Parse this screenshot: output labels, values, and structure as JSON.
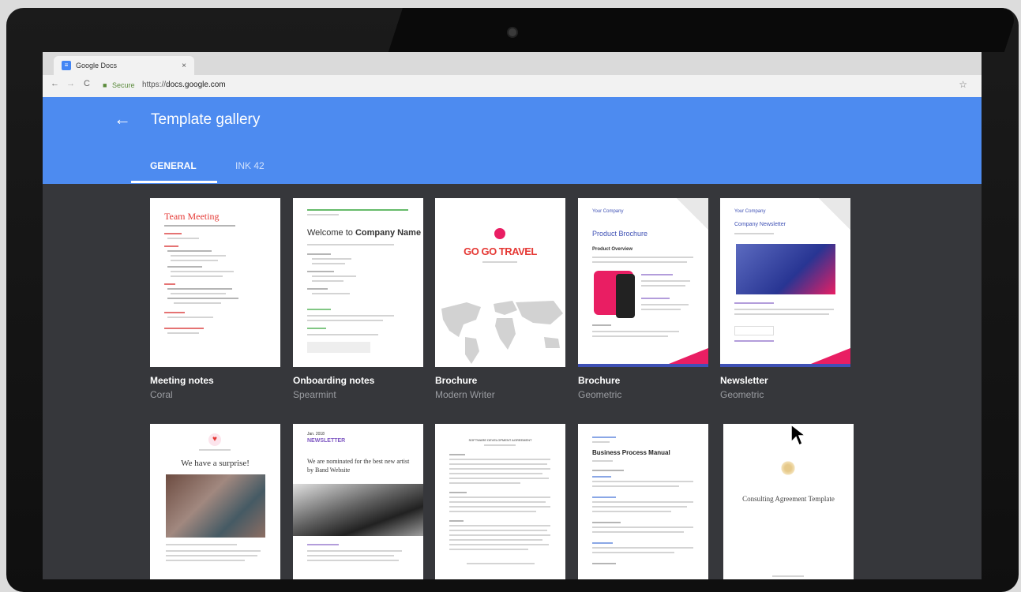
{
  "browser": {
    "tab_title": "Google Docs",
    "tab_close": "×",
    "secure_label": "Secure",
    "url_prefix": "https://",
    "url_host": "docs.google.com",
    "back_glyph": "←",
    "forward_glyph": "→",
    "reload_glyph": "C"
  },
  "gallery": {
    "title": "Template gallery",
    "tabs": [
      {
        "label": "GENERAL",
        "active": true
      },
      {
        "label": "INK 42",
        "active": false
      }
    ]
  },
  "templates": [
    {
      "name": "Meeting notes",
      "style": "Coral",
      "thumb_title": "Team Meeting"
    },
    {
      "name": "Onboarding notes",
      "style": "Spearmint",
      "thumb_title_plain": "Welcome to",
      "thumb_title_bold": "Company Name"
    },
    {
      "name": "Brochure",
      "style": "Modern Writer",
      "thumb_title": "GO GO TRAVEL"
    },
    {
      "name": "Brochure",
      "style": "Geometric",
      "thumb_kicker": "Your Company",
      "thumb_title": "Product Brochure",
      "thumb_heading": "Product Overview"
    },
    {
      "name": "Newsletter",
      "style": "Geometric",
      "thumb_kicker": "Your Company",
      "thumb_title": "Company Newsletter"
    }
  ],
  "templates_row2": [
    {
      "thumb_title": "We have a surprise!"
    },
    {
      "thumb_kicker": "Jan. 2018",
      "thumb_title": "NEWSLETTER",
      "thumb_heading": "We are nominated for the best new artist by Band Website"
    },
    {
      "thumb_title": "SOFTWARE DEVELOPMENT AGREEMENT"
    },
    {
      "thumb_title": "Business Process Manual"
    },
    {
      "thumb_title": "Consulting Agreement Template"
    }
  ],
  "colors": {
    "header_blue": "#4d8bf0",
    "page_bg": "#36373b",
    "coral": "#e53935",
    "spearmint": "#4caf50",
    "geometric_blue": "#3f51b5",
    "geometric_pink": "#e91e63"
  }
}
